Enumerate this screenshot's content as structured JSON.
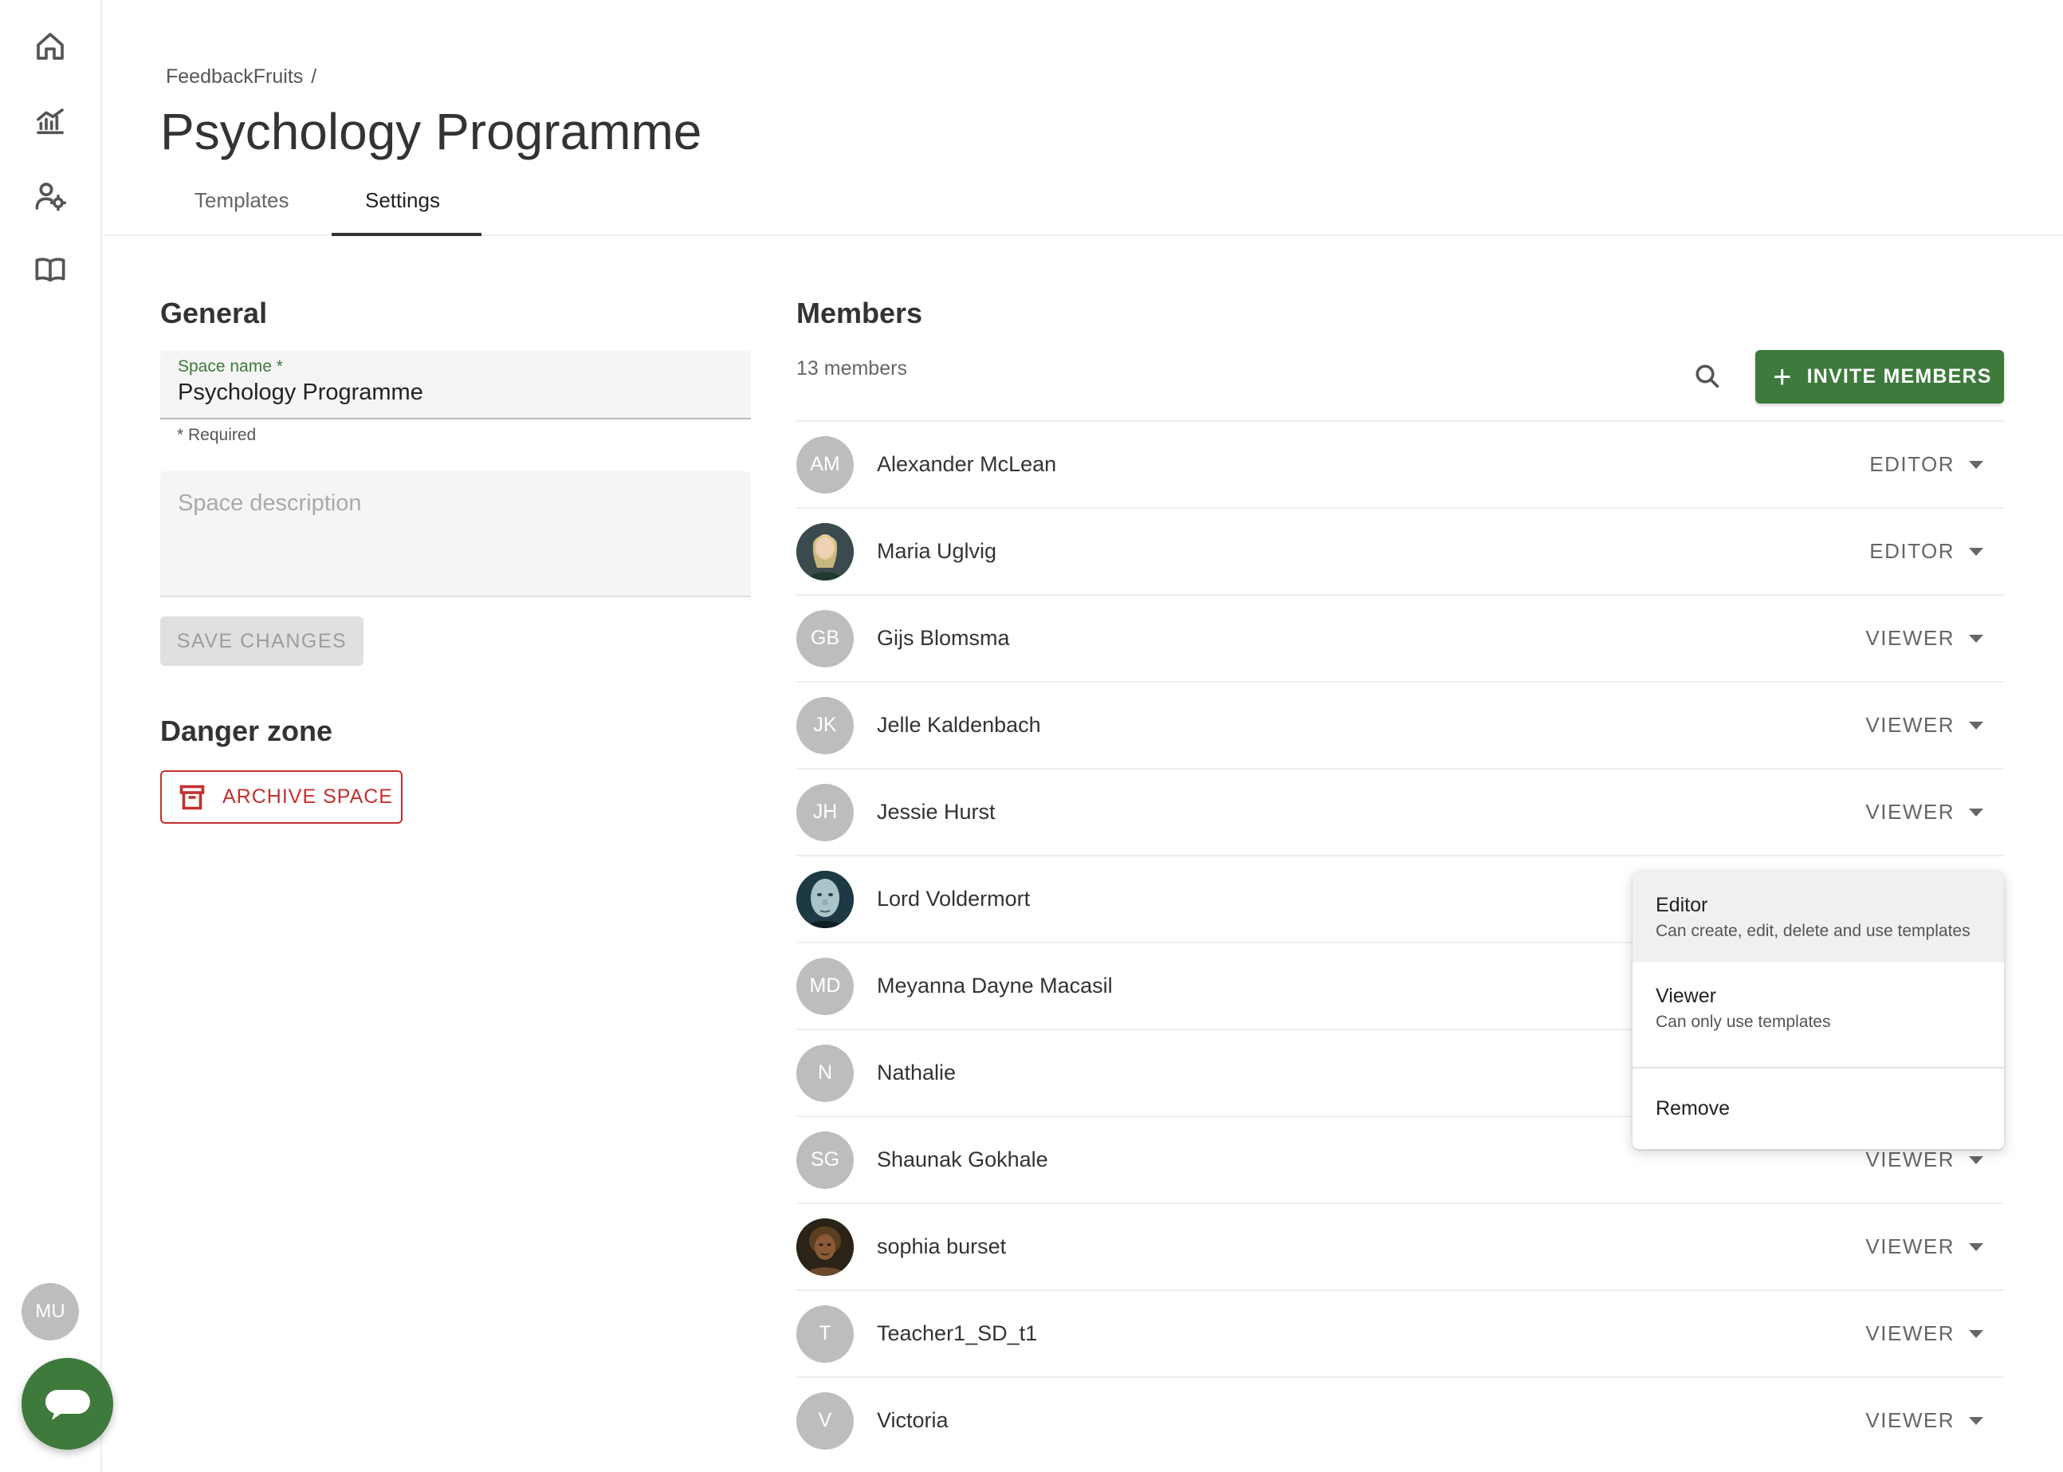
{
  "breadcrumb": {
    "root": "FeedbackFruits",
    "separator": "/"
  },
  "page": {
    "title": "Psychology Programme"
  },
  "tabs": [
    {
      "label": "Templates",
      "active": false
    },
    {
      "label": "Settings",
      "active": true
    }
  ],
  "general": {
    "title": "General",
    "space_name_label": "Space name *",
    "space_name_value": "Psychology Programme",
    "required_helper": "* Required",
    "description_placeholder": "Space description",
    "save_label": "SAVE CHANGES"
  },
  "danger": {
    "title": "Danger zone",
    "archive_label": "ARCHIVE SPACE"
  },
  "members": {
    "title": "Members",
    "count_label": "13 members",
    "invite_label": "INVITE MEMBERS",
    "list": [
      {
        "initials": "AM",
        "name": "Alexander McLean",
        "role": "EDITOR",
        "photo": false
      },
      {
        "initials": "",
        "name": "Maria Uglvig",
        "role": "EDITOR",
        "photo": true
      },
      {
        "initials": "GB",
        "name": "Gijs Blomsma",
        "role": "VIEWER",
        "photo": false
      },
      {
        "initials": "JK",
        "name": "Jelle Kaldenbach",
        "role": "VIEWER",
        "photo": false
      },
      {
        "initials": "JH",
        "name": "Jessie Hurst",
        "role": "VIEWER",
        "photo": false
      },
      {
        "initials": "",
        "name": "Lord Voldermort",
        "role": "",
        "photo": true
      },
      {
        "initials": "MD",
        "name": "Meyanna Dayne Macasil",
        "role": "",
        "photo": false
      },
      {
        "initials": "N",
        "name": "Nathalie",
        "role": "",
        "photo": false
      },
      {
        "initials": "SG",
        "name": "Shaunak Gokhale",
        "role": "VIEWER",
        "photo": false
      },
      {
        "initials": "",
        "name": "sophia burset",
        "role": "VIEWER",
        "photo": true
      },
      {
        "initials": "T",
        "name": "Teacher1_SD_t1",
        "role": "VIEWER",
        "photo": false
      },
      {
        "initials": "V",
        "name": "Victoria",
        "role": "VIEWER",
        "photo": false
      }
    ]
  },
  "role_menu": {
    "editor_title": "Editor",
    "editor_desc": "Can create, edit, delete and use templates",
    "viewer_title": "Viewer",
    "viewer_desc": "Can only use templates",
    "remove_label": "Remove"
  },
  "user": {
    "initials": "MU"
  },
  "sidebar": {
    "icons": [
      "home-icon",
      "analytics-icon",
      "user-settings-icon",
      "book-icon"
    ]
  },
  "colors": {
    "primary": "#3d7a3b",
    "danger": "#c53030",
    "avatar_gray": "#bdbdbd"
  }
}
